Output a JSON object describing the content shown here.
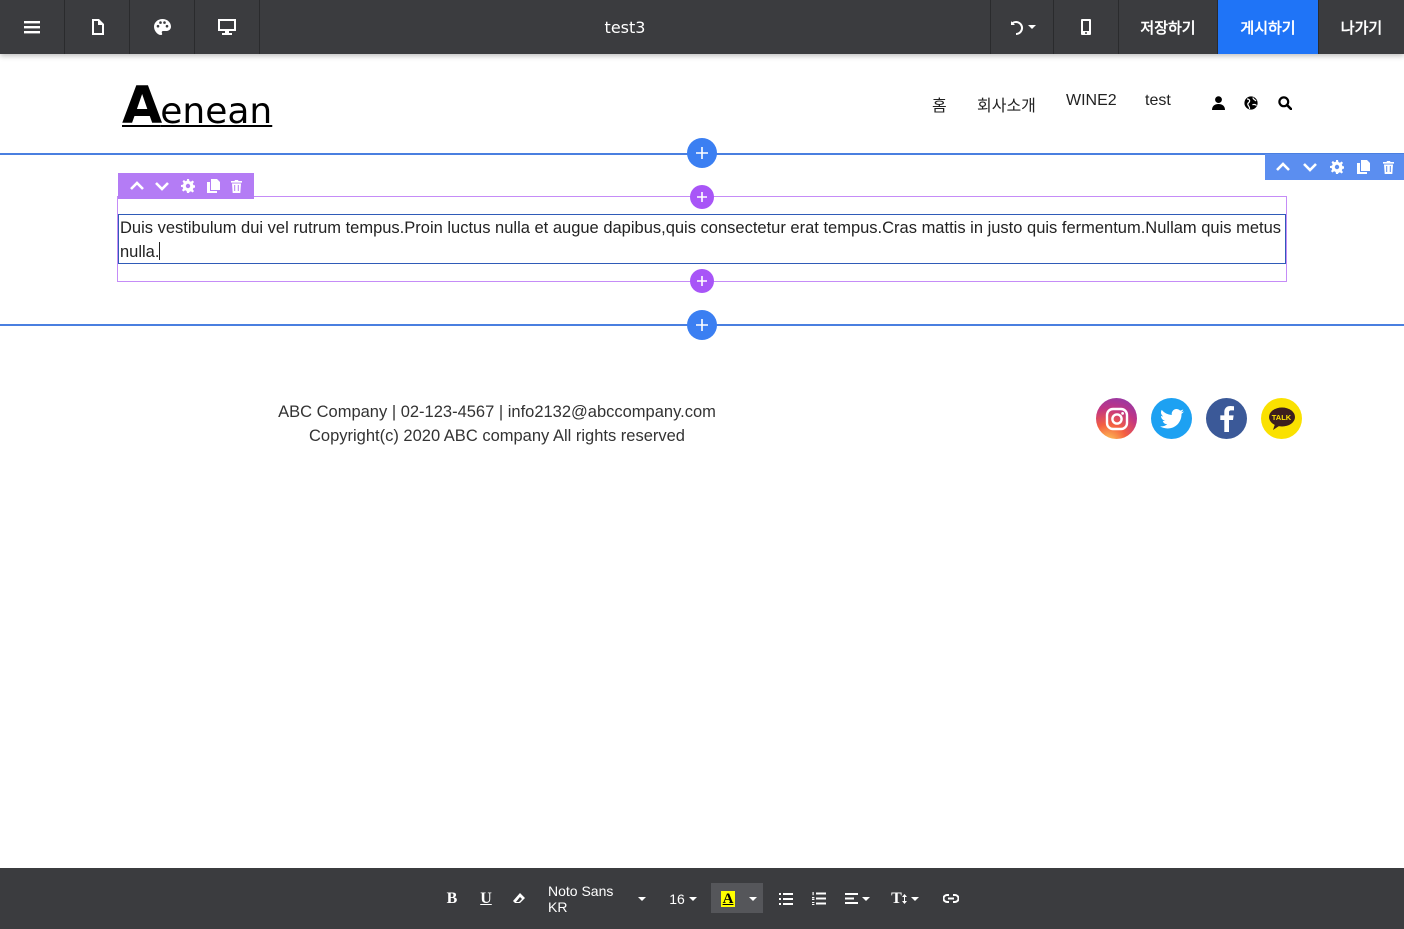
{
  "topbar": {
    "menu_icon": "hamburger-icon",
    "page_icon": "file-icon",
    "palette_icon": "palette-icon",
    "desktop_icon": "desktop-icon",
    "title": "test3",
    "undo_icon": "undo-icon",
    "mobile_icon": "mobile-icon",
    "save_label": "저장하기",
    "publish_label": "게시하기",
    "exit_label": "나가기",
    "publish_color": "#1f74f7"
  },
  "site": {
    "logo_big": "A",
    "logo_rest": "enean",
    "nav": [
      "홈",
      "회사소개",
      "WINE2",
      "test"
    ],
    "nav_icons": [
      "user-icon",
      "globe-icon",
      "search-icon"
    ]
  },
  "editor": {
    "text": "Duis vestibulum dui vel rutrum tempus.Proin luctus nulla et augue dapibus,quis consectetur erat tempus.Cras mattis in justo quis fermentum.Nullam quis metus nulla.",
    "section_color": "#4a7fe0",
    "block_color": "#a855f7"
  },
  "footer": {
    "line1": "ABC Company | 02-123-4567 | info2132@abccompany.com",
    "line2": "Copyright(c) 2020 ABC company All rights reserved",
    "social": [
      "instagram-icon",
      "twitter-icon",
      "facebook-icon",
      "kakaotalk-icon"
    ],
    "talk_label": "TALK"
  },
  "toolbar": {
    "bold": "B",
    "underline": "U",
    "font": "Noto Sans KR",
    "size": "16",
    "highlight_letter": "A",
    "textsize_label": "T",
    "highlight_color": "#ffff00"
  }
}
